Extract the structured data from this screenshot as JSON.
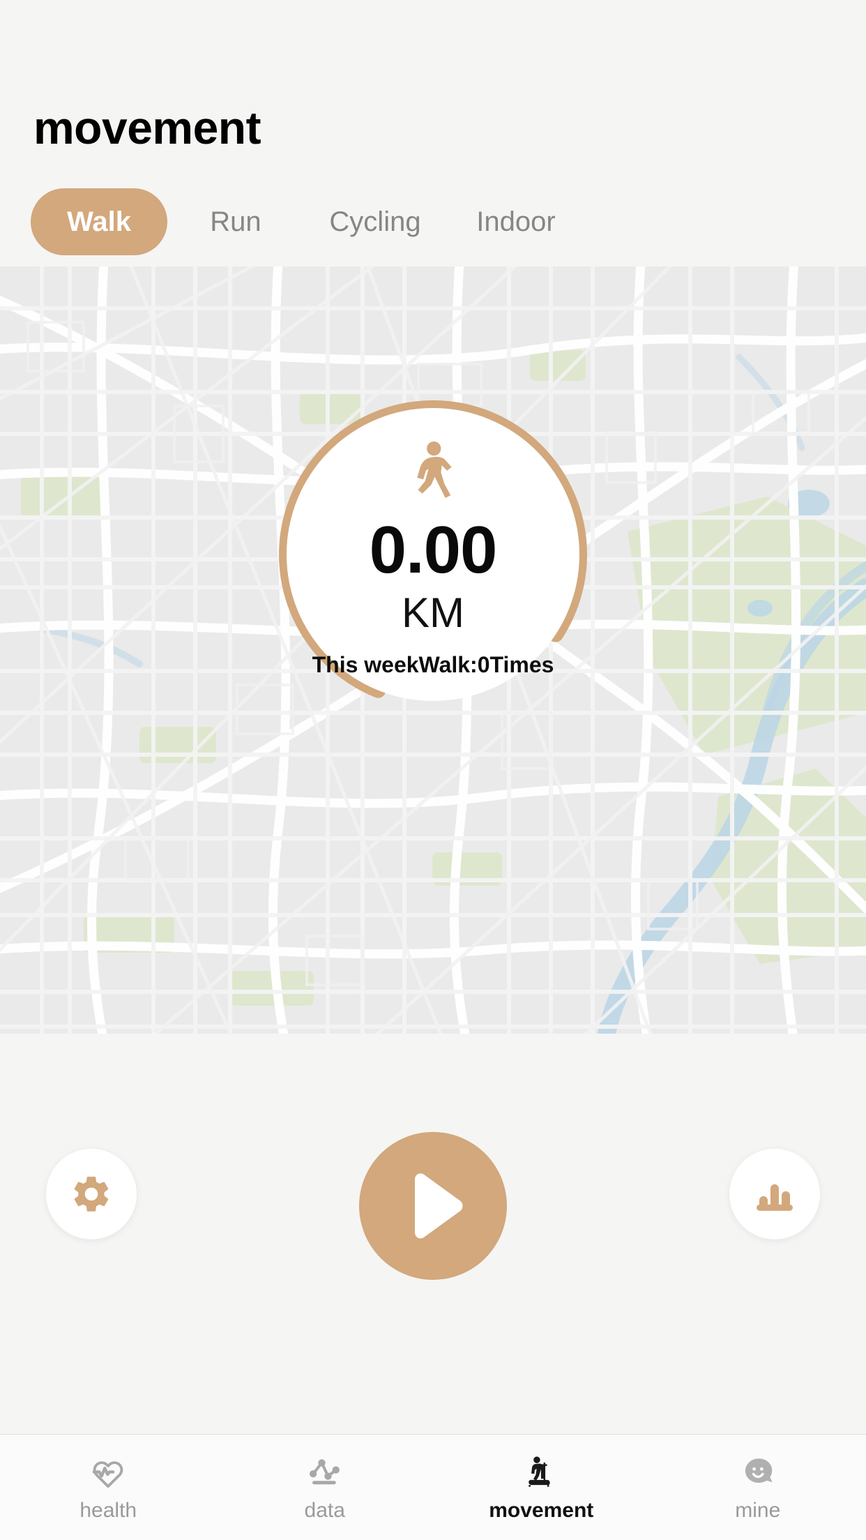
{
  "header": {
    "title": "movement"
  },
  "tabs": [
    {
      "label": "Walk",
      "icon": "walk-icon",
      "active": true
    },
    {
      "label": "Run",
      "icon": "run-icon",
      "active": false
    },
    {
      "label": "Cycling",
      "icon": "cycling-icon",
      "active": false
    },
    {
      "label": "Indoor",
      "icon": "indoor-icon",
      "active": false
    }
  ],
  "tracker": {
    "activity_icon": "walking-person-icon",
    "distance_value": "0.00",
    "distance_unit": "KM",
    "week_stats": "This weekWalk:0Times",
    "progress_percent": 78
  },
  "actions": {
    "settings": {
      "label": "Settings",
      "icon": "gear-icon"
    },
    "start": {
      "label": "Start",
      "icon": "play-icon"
    },
    "stats": {
      "label": "Stats",
      "icon": "bar-chart-icon"
    }
  },
  "bottom_nav": [
    {
      "label": "health",
      "icon": "heart-pulse-icon",
      "active": false
    },
    {
      "label": "data",
      "icon": "line-chart-icon",
      "active": false
    },
    {
      "label": "movement",
      "icon": "treadmill-icon",
      "active": true
    },
    {
      "label": "mine",
      "icon": "smiley-face-icon",
      "active": false
    }
  ],
  "colors": {
    "accent": "#d2a87c",
    "background": "#f5f5f4",
    "text_primary": "#000000",
    "text_muted": "#868686",
    "map_land": "#eaeaea",
    "map_road": "#f7f7f7",
    "map_park": "#dbe6c8",
    "map_water": "#bcd6e5"
  }
}
